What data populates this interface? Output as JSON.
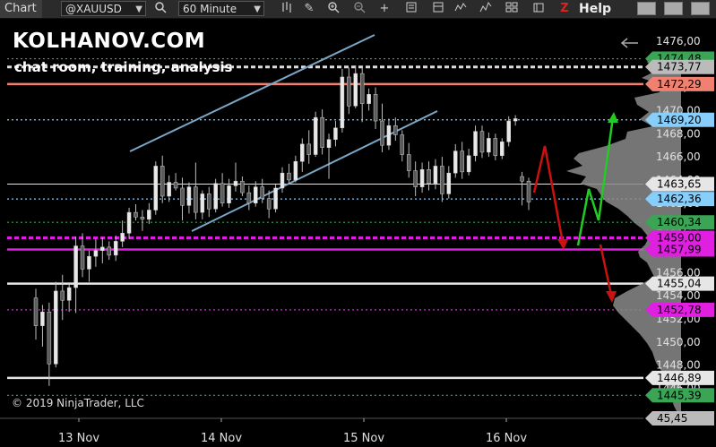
{
  "toolbar": {
    "tab_label": "Chart",
    "instrument": "@XAUUSD",
    "interval": "60 Minute",
    "help_label": "Help",
    "z_label": "Z"
  },
  "branding": {
    "title": "KOLHANOV.COM",
    "subtitle": "chat room, training, analysis"
  },
  "copyright": "© 2019 NinjaTrader, LLC",
  "colors": {
    "background": "#000000",
    "channel": "#7aa7c7",
    "arrow_up": "#22cc22",
    "arrow_down": "#cc1111",
    "magenta": "#e020e0"
  },
  "chart_data": {
    "type": "candlestick",
    "x_ticks": [
      "13 Nov",
      "14 Nov",
      "15 Nov",
      "16 Nov"
    ],
    "y_ticks": [
      "1476,00",
      "1472,00",
      "1470,00",
      "1468,00",
      "1466,00",
      "1464,00",
      "1462,00",
      "1460,00",
      "1458,00",
      "1456,00",
      "1454,00",
      "1452,00",
      "1450,00",
      "1448,00",
      "1446,00"
    ],
    "ylim": [
      1443.4,
      1477.0
    ],
    "price_labels": [
      {
        "text": "1474,48",
        "value": 1474.48,
        "color": "#3aa655"
      },
      {
        "text": "1473,77",
        "value": 1473.77,
        "color": "#bbbbbb"
      },
      {
        "text": "1472,29",
        "value": 1472.29,
        "color": "#f08070"
      },
      {
        "text": "1469,20",
        "value": 1469.2,
        "color": "#87cefa"
      },
      {
        "text": "1463,65",
        "value": 1463.65,
        "color": "#e6e6e6"
      },
      {
        "text": "1462,36",
        "value": 1462.36,
        "color": "#87cefa"
      },
      {
        "text": "1460,34",
        "value": 1460.34,
        "color": "#3aa655"
      },
      {
        "text": "1459,00",
        "value": 1459.0,
        "color": "#e020e0"
      },
      {
        "text": "1457,99",
        "value": 1457.99,
        "color": "#e020e0"
      },
      {
        "text": "1455,04",
        "value": 1455.04,
        "color": "#e6e6e6"
      },
      {
        "text": "1452,78",
        "value": 1452.78,
        "color": "#e020e0"
      },
      {
        "text": "1446,89",
        "value": 1446.89,
        "color": "#e6e6e6"
      },
      {
        "text": "1445,39",
        "value": 1445.39,
        "color": "#3aa655"
      },
      {
        "text": "45,45",
        "value": 1443.4,
        "color": "#bbbbbb"
      }
    ],
    "levels": [
      {
        "value": 1474.48,
        "color": "#3aa655",
        "style": "dotted"
      },
      {
        "value": 1473.77,
        "color": "#dddddd",
        "style": "dashed-thick"
      },
      {
        "value": 1472.29,
        "color": "#f08070",
        "style": "solid-thick"
      },
      {
        "value": 1469.2,
        "color": "#87cefa",
        "style": "dotted"
      },
      {
        "value": 1463.65,
        "color": "#e6e6e6",
        "style": "solid"
      },
      {
        "value": 1462.36,
        "color": "#87cefa",
        "style": "dotted"
      },
      {
        "value": 1460.34,
        "color": "#3aa655",
        "style": "dotted"
      },
      {
        "value": 1459.0,
        "color": "#e020e0",
        "style": "dashed-thick"
      },
      {
        "value": 1457.99,
        "color": "#e020e0",
        "style": "solid-thick"
      },
      {
        "value": 1455.04,
        "color": "#e6e6e6",
        "style": "solid-thick"
      },
      {
        "value": 1452.78,
        "color": "#e020e0",
        "style": "dotted"
      },
      {
        "value": 1446.89,
        "color": "#e6e6e6",
        "style": "solid-thick"
      },
      {
        "value": 1445.39,
        "color": "#3aa655",
        "style": "dotted"
      }
    ],
    "candles": [
      [
        1453.8,
        1454.6,
        1450.2,
        1451.4
      ],
      [
        1451.4,
        1453.2,
        1449.6,
        1452.6
      ],
      [
        1452.6,
        1453.4,
        1446.2,
        1448.1
      ],
      [
        1448.1,
        1455.2,
        1447.8,
        1454.4
      ],
      [
        1454.4,
        1455.8,
        1451.9,
        1453.6
      ],
      [
        1453.6,
        1455.0,
        1452.6,
        1454.7
      ],
      [
        1454.7,
        1459.1,
        1452.5,
        1458.3
      ],
      [
        1458.3,
        1459.4,
        1455.6,
        1456.3
      ],
      [
        1456.3,
        1457.9,
        1455.2,
        1457.4
      ],
      [
        1457.4,
        1458.9,
        1456.5,
        1457.9
      ],
      [
        1457.9,
        1459.0,
        1456.8,
        1458.2
      ],
      [
        1458.2,
        1458.7,
        1457.1,
        1457.5
      ],
      [
        1457.5,
        1459.2,
        1457.0,
        1458.7
      ],
      [
        1458.7,
        1460.5,
        1458.2,
        1459.4
      ],
      [
        1459.4,
        1461.6,
        1458.9,
        1461.2
      ],
      [
        1461.2,
        1461.9,
        1460.5,
        1460.8
      ],
      [
        1460.8,
        1461.4,
        1459.6,
        1460.6
      ],
      [
        1460.6,
        1462.0,
        1460.2,
        1461.4
      ],
      [
        1461.4,
        1465.6,
        1461.0,
        1465.2
      ],
      [
        1465.2,
        1466.1,
        1462.0,
        1462.6
      ],
      [
        1462.6,
        1464.4,
        1462.1,
        1463.8
      ],
      [
        1463.8,
        1464.6,
        1463.1,
        1463.3
      ],
      [
        1463.3,
        1464.2,
        1460.5,
        1461.8
      ],
      [
        1461.8,
        1463.8,
        1461.1,
        1463.4
      ],
      [
        1463.4,
        1465.5,
        1460.6,
        1461.2
      ],
      [
        1461.2,
        1463.1,
        1460.6,
        1462.8
      ],
      [
        1462.8,
        1463.4,
        1460.8,
        1461.5
      ],
      [
        1461.5,
        1464.1,
        1461.2,
        1463.7
      ],
      [
        1463.7,
        1464.6,
        1461.7,
        1462.0
      ],
      [
        1462.0,
        1464.1,
        1461.6,
        1463.5
      ],
      [
        1463.5,
        1465.5,
        1463.0,
        1463.9
      ],
      [
        1463.9,
        1464.3,
        1462.6,
        1462.9
      ],
      [
        1462.9,
        1463.5,
        1461.4,
        1462.0
      ],
      [
        1462.0,
        1463.9,
        1461.7,
        1463.4
      ],
      [
        1463.4,
        1464.1,
        1462.0,
        1462.4
      ],
      [
        1462.4,
        1463.1,
        1460.7,
        1461.5
      ],
      [
        1461.5,
        1463.6,
        1461.2,
        1463.3
      ],
      [
        1463.3,
        1465.1,
        1462.9,
        1464.6
      ],
      [
        1464.6,
        1465.4,
        1463.6,
        1464.0
      ],
      [
        1464.0,
        1466.1,
        1463.8,
        1465.6
      ],
      [
        1465.6,
        1467.6,
        1464.7,
        1467.1
      ],
      [
        1467.1,
        1468.3,
        1465.4,
        1466.2
      ],
      [
        1466.2,
        1469.9,
        1466.0,
        1469.4
      ],
      [
        1469.4,
        1470.1,
        1466.2,
        1466.8
      ],
      [
        1466.8,
        1468.0,
        1464.1,
        1467.5
      ],
      [
        1467.5,
        1469.1,
        1466.9,
        1468.5
      ],
      [
        1468.5,
        1473.6,
        1468.1,
        1472.9
      ],
      [
        1472.9,
        1473.7,
        1469.7,
        1470.4
      ],
      [
        1470.4,
        1473.9,
        1470.2,
        1473.2
      ],
      [
        1473.2,
        1473.8,
        1469.0,
        1470.6
      ],
      [
        1470.6,
        1471.9,
        1470.0,
        1471.4
      ],
      [
        1471.4,
        1472.0,
        1468.4,
        1469.1
      ],
      [
        1469.1,
        1470.6,
        1466.4,
        1467.0
      ],
      [
        1467.0,
        1469.3,
        1466.6,
        1468.7
      ],
      [
        1468.7,
        1469.4,
        1467.4,
        1467.9
      ],
      [
        1467.9,
        1468.3,
        1465.6,
        1466.2
      ],
      [
        1466.2,
        1467.2,
        1464.2,
        1464.8
      ],
      [
        1464.8,
        1465.6,
        1462.6,
        1463.4
      ],
      [
        1463.4,
        1465.5,
        1462.9,
        1464.9
      ],
      [
        1464.9,
        1465.6,
        1463.1,
        1463.7
      ],
      [
        1463.7,
        1465.8,
        1463.2,
        1465.2
      ],
      [
        1465.2,
        1466.0,
        1462.1,
        1462.8
      ],
      [
        1462.8,
        1465.2,
        1462.4,
        1464.6
      ],
      [
        1464.6,
        1467.1,
        1464.2,
        1466.5
      ],
      [
        1466.5,
        1467.3,
        1464.1,
        1464.7
      ],
      [
        1464.7,
        1466.7,
        1464.4,
        1466.1
      ],
      [
        1466.1,
        1468.7,
        1465.6,
        1468.2
      ],
      [
        1468.2,
        1468.7,
        1465.9,
        1466.4
      ],
      [
        1466.4,
        1468.1,
        1466.0,
        1467.6
      ],
      [
        1467.6,
        1468.0,
        1465.7,
        1466.1
      ],
      [
        1466.1,
        1467.6,
        1465.8,
        1467.3
      ],
      [
        1467.3,
        1469.5,
        1466.9,
        1469.1
      ],
      [
        1469.1,
        1469.6,
        1468.7,
        1469.3
      ],
      [
        1464.3,
        1464.7,
        1461.8,
        1463.9
      ],
      [
        1463.9,
        1464.2,
        1461.4,
        1462.1
      ]
    ]
  }
}
